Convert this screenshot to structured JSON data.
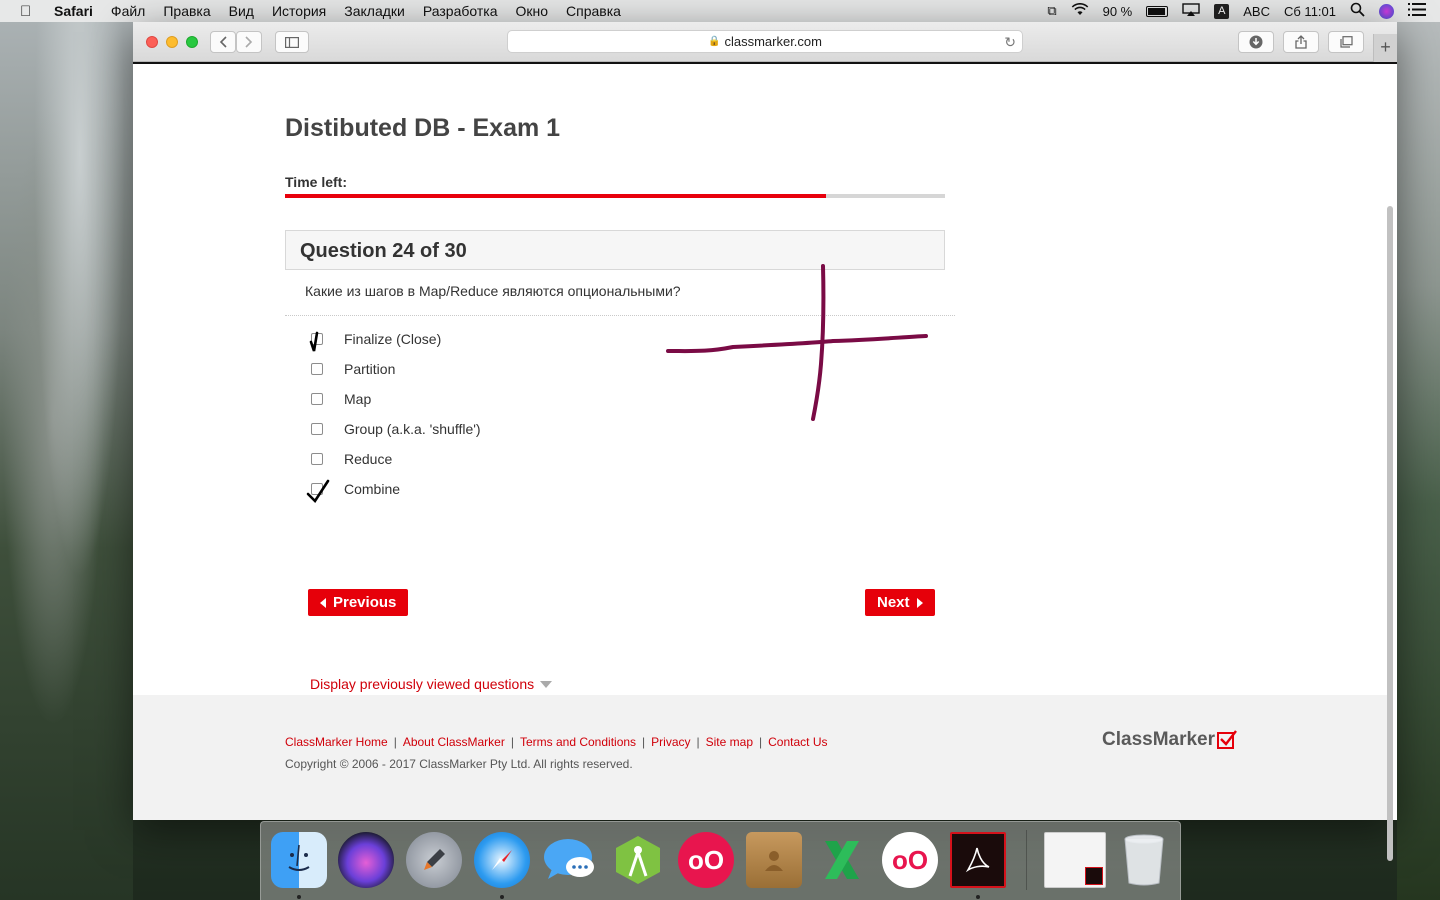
{
  "menubar": {
    "app_name": "Safari",
    "items": [
      "Файл",
      "Правка",
      "Вид",
      "История",
      "Закладки",
      "Разработка",
      "Окно",
      "Справка"
    ],
    "battery": "90 %",
    "input_source": "ABC",
    "input_badge": "A",
    "clock": "Сб 11:01"
  },
  "browser": {
    "url": "classmarker.com"
  },
  "exam": {
    "title": "Distibuted DB - Exam 1",
    "time_left_label": "Time left:",
    "time_left_fraction": 0.82,
    "question_header": "Question 24 of 30",
    "question_text": "Какие из шагов в Map/Reduce являются опциональными?",
    "options": [
      {
        "label": "Finalize (Close)",
        "checked": true
      },
      {
        "label": "Partition",
        "checked": false
      },
      {
        "label": "Map",
        "checked": false
      },
      {
        "label": "Group (a.k.a. 'shuffle')",
        "checked": false
      },
      {
        "label": "Reduce",
        "checked": false
      },
      {
        "label": "Combine",
        "checked": true
      }
    ],
    "previous_label": "Previous",
    "next_label": "Next",
    "prev_viewed_label": "Display previously viewed questions"
  },
  "footer": {
    "links": [
      "ClassMarker Home",
      "About ClassMarker",
      "Terms and Conditions",
      "Privacy",
      "Site map",
      "Contact Us"
    ],
    "copyright": "Copyright © 2006 - 2017 ClassMarker Pty Ltd. All rights reserved.",
    "brand": "ClassMarker"
  },
  "colors": {
    "accent_red": "#e6000a",
    "annotation_stroke": "#7a0b45"
  }
}
